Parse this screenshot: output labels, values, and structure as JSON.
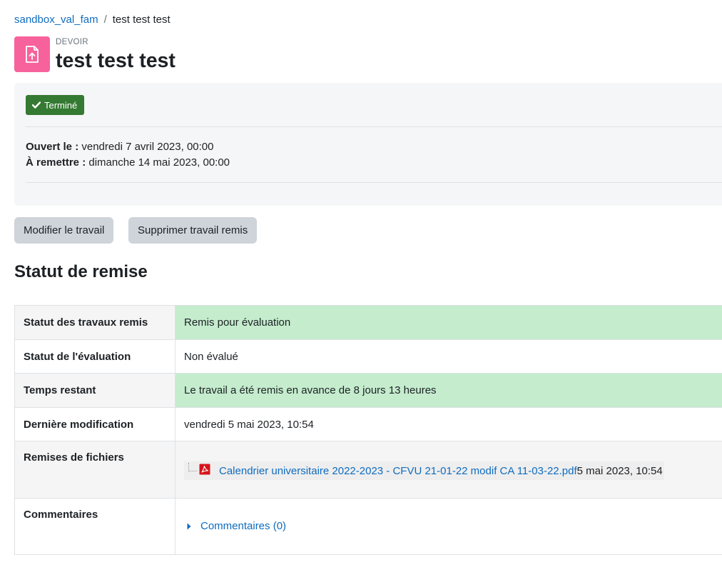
{
  "breadcrumb": {
    "parent": "sandbox_val_fam",
    "separator": "/",
    "current": "test test test"
  },
  "header": {
    "activity_icon": "assignment-upload-icon",
    "activity_kind": "DEVOIR",
    "title": "test test test"
  },
  "colors": {
    "accent_link": "#0f6cbf",
    "activity_icon_bg": "#f7629c",
    "badge_success": "#357a32",
    "status_ok_bg": "#c4eccd",
    "button_bg": "#ced4da"
  },
  "info": {
    "badge_icon": "check-icon",
    "badge_label": "Terminé",
    "opened_label": "Ouvert le :",
    "opened_value": "vendredi 7 avril 2023, 00:00",
    "due_label": "À remettre :",
    "due_value": "dimanche 14 mai 2023, 00:00"
  },
  "actions": {
    "edit_label": "Modifier le travail",
    "delete_label": "Supprimer travail remis"
  },
  "submission": {
    "title": "Statut de remise",
    "rows": {
      "submission_status": {
        "label": "Statut des travaux remis",
        "value": "Remis pour évaluation"
      },
      "grading_status": {
        "label": "Statut de l'évaluation",
        "value": "Non évalué"
      },
      "time_remaining": {
        "label": "Temps restant",
        "value": "Le travail a été remis en avance de 8 jours 13 heures"
      },
      "last_modified": {
        "label": "Dernière modification",
        "value": "vendredi 5 mai 2023, 10:54"
      },
      "file_submissions": {
        "label": "Remises de fichiers",
        "file_icon": "pdf-file-icon",
        "file_name": "Calendrier universitaire 2022-2023 - CFVU 21-01-22 modif CA 11-03-22.pdf",
        "file_date": "5 mai 2023, 10:54"
      },
      "comments": {
        "label": "Commentaires",
        "toggle_icon": "caret-right-icon",
        "link": "Commentaires (0)"
      }
    }
  }
}
